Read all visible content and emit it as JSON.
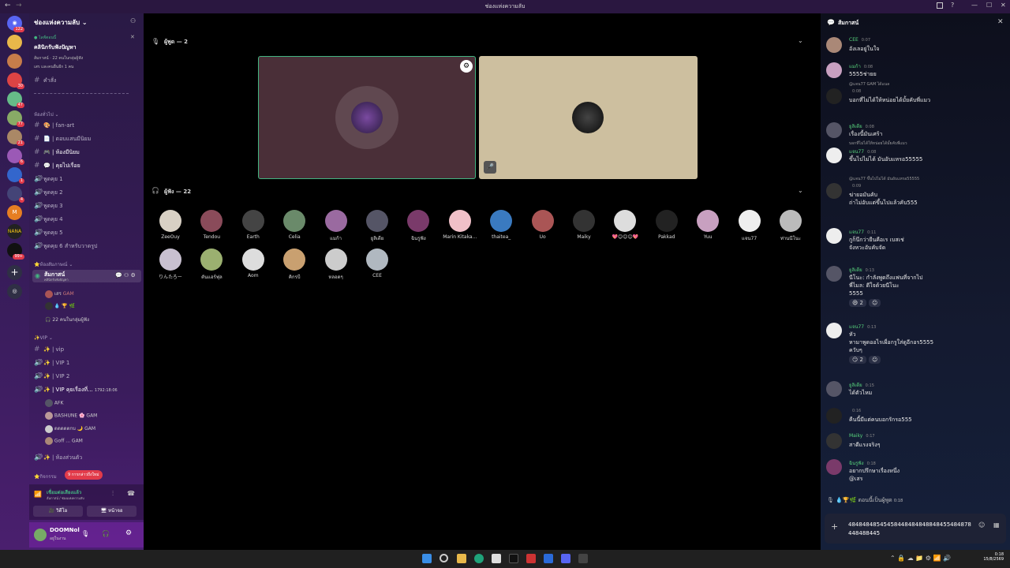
{
  "window": {
    "title": "ช่องแห่งความลับ"
  },
  "server": {
    "name": "ช่องแห่งความลับ",
    "event": {
      "status": "ไลฟ์ตอนนี้",
      "title": "คลินิกรับฟังปัญหา",
      "meta": "ส้มกาสน์ · 22 คนในกลุ่มผู้ฟัง",
      "members": "เสร และคนอื่นอีก 1 คน"
    },
    "pinned_channel": "คำสั่ง",
    "categories": [
      {
        "name": "ห้องทั่วไป",
        "channels": [
          "🎨 | fan-art",
          "📄 | ตอบแสนมีนิยม",
          "🎮 | ห้องมีนิยม",
          "💬 | คุยไปเรื่อย"
        ]
      },
      {
        "name": "",
        "channels": [
          "พูดคุย 1",
          "พูดคุย 2",
          "พูดคุย 3",
          "พูดคุย 4",
          "พูดคุย 5",
          "พูดคุย 6 สำหรับวาดรูป"
        ]
      }
    ],
    "stage_category": "ห้องสัมภาษณ์",
    "stage_channel": {
      "name": "ส้มกาสน์",
      "subtitle": "คลินิกรับฟังปัญหา",
      "speaker": "เสร",
      "speaker_badge": "GAM",
      "listeners": "22 คนในกลุ่มผู้ฟัง"
    },
    "vip_category": "VIP",
    "vip_channels": [
      "✨ | vip",
      "✨ | VIP 1",
      "✨ | VIP 2"
    ],
    "vip_voice": {
      "name": "✨ | VIP คุยเรื่องที่...",
      "timer": "1792:18:06",
      "members": [
        "AFK",
        "BASHUNE",
        "ดดดดตกบ",
        "Goff"
      ]
    },
    "private_channel": "✨ | ห้องส่วนตัว",
    "more_category": "กิจกรรม",
    "new_mentions": "9 การกล่าวถึงใหม่"
  },
  "voice_status": {
    "title": "เชื่อมต่อเสียงแล้ว",
    "subtitle": "ส้มกาสน์ / ช่องแห่งความลับ",
    "video_label": "วิดีโอ",
    "screen_label": "หน้าจอ"
  },
  "user_panel": {
    "name": "DOOMNol",
    "status": "อยู่ในงาน"
  },
  "stage": {
    "speakers_header": "ผู้พูด — 2",
    "listeners_header": "ผู้ฟัง — 22",
    "listeners": [
      "ZeeOuy",
      "Tendou",
      "Earth",
      "Celia",
      "แมก้า",
      "ยูลิเดีย",
      "ฉินรูฟัง",
      "Marin Kitaka...",
      "thaitea_",
      "Uo",
      "Maiky",
      "💖😊😊😊💖",
      "Pakkad",
      "Yuu",
      "แจน77",
      "ท่านนีโนะ",
      "りんたろー",
      "ตันแอร์ฟุล",
      "Aom",
      "คิกรบี",
      "หลอดๆ",
      "CEE"
    ]
  },
  "chat": {
    "title": "ส้มกาสน์",
    "messages": [
      {
        "author": "CEE",
        "time": "0:07",
        "color": "#57d37c",
        "lines": [
          "อังเลอยู่ในใจ"
        ]
      },
      {
        "author": "แมก้า",
        "time": "0:08",
        "color": "#57d37c",
        "lines": [
          "5555ช่ายย"
        ]
      },
      {
        "author": "",
        "time": "0:08",
        "color": "#aaa",
        "reply": "@แจน77 GAM ได้แนล",
        "lines": [
          "บอกที่ไม่ได้ให้หน่อยได้มั้ยคับพี่แมว"
        ]
      },
      {
        "author": "ยูลิเดีย",
        "time": "0:08",
        "color": "#57d37c",
        "lines": [
          "เรื่องนี้มันเศร้า"
        ]
      },
      {
        "author": "แจน77",
        "time": "0:08",
        "color": "#57d37c",
        "reply": "บอกที่ไม่ได้ให้หน่อยได้มั้ยคับพี่แมว",
        "lines": [
          "ขึ้นไปไม่ได้ มันอับแหรอ55555"
        ]
      },
      {
        "author": "",
        "time": "0:09",
        "color": "#aaa",
        "reply": "@แจน77 ขึ้นไปไม่ได้ มันอับแหรอ55555",
        "lines": [
          "ฆ่ายอมันคับ",
          "ถ่าไม่อับแต่ขึ้นไปแล้วคับ555"
        ]
      },
      {
        "author": "แจน77",
        "time": "0:11",
        "color": "#57d37c",
        "lines": [
          "กูก็นึกว่ายืนคือเร เบสเช่",
          "จังหวะอับคับจัด"
        ]
      },
      {
        "author": "ยูลิเดีย",
        "time": "0:13",
        "color": "#57d37c",
        "lines": [
          "นีโนะ: กำลังพูดถึงแฟนที่จากไป",
          "พี่ไมล: ดีใจด้วยนีโนะ",
          "5555"
        ],
        "reactions": [
          "😄 2"
        ]
      },
      {
        "author": "แจน77",
        "time": "0:13",
        "color": "#57d37c",
        "lines": [
          "หัว",
          "หามาพูดออไรเผื่อกรูใส่ดูอีกอร5555",
          "ควับๆ"
        ],
        "reactions": [
          "😏 2"
        ]
      },
      {
        "author": "ยูลิเดีย",
        "time": "0:15",
        "color": "#57d37c",
        "lines": [
          "ได้ตัวไหม"
        ]
      },
      {
        "author": "",
        "time": "0:16",
        "color": "#aaa",
        "lines": [
          "คืนนี้มีแต่คนบอกรักรอ555"
        ]
      },
      {
        "author": "Maiky",
        "time": "0:17",
        "color": "#57d37c",
        "lines": [
          "สาดีแรงจริงๆ"
        ]
      },
      {
        "author": "ฉินรูฟัง",
        "time": "0:18",
        "color": "#57d37c",
        "lines": [
          "อยากปรึกษาเรื่องหนึ่ง",
          "@เสร"
        ]
      }
    ],
    "system": "ตอนนี้เป็นผู้พูด",
    "system_time": "0:18",
    "input_value": "48484848545458448484848848455484878448488445"
  },
  "taskbar": {
    "time": "0:18",
    "date": "15/8/2569"
  },
  "colors": {
    "accent": "#5865f2",
    "speaker_tile": "#4a2f38",
    "speaker2_tile": "#cdbf9f",
    "live_green": "#43b581",
    "mention_red": "#e23b4a"
  }
}
